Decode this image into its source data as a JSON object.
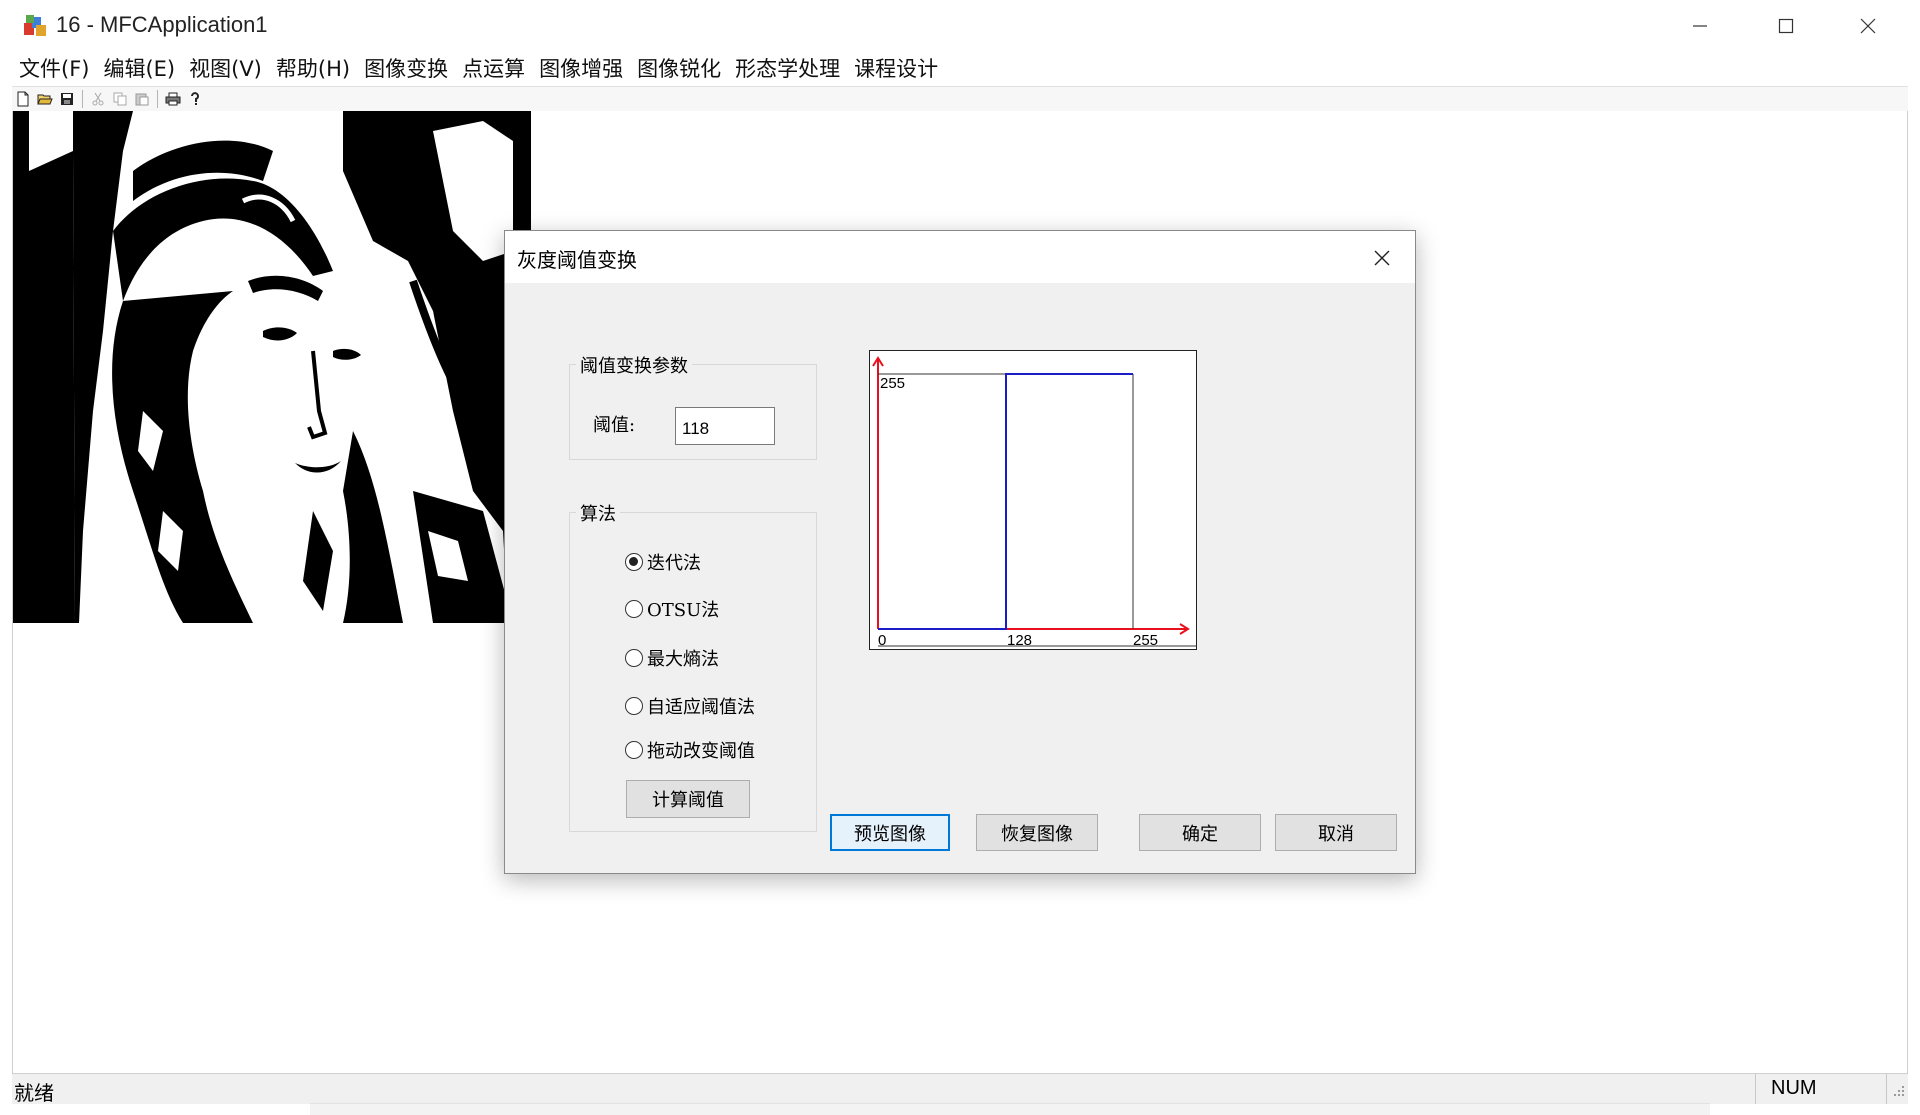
{
  "window": {
    "title": "16 - MFCApplication1",
    "icon": "mfc-app-icon"
  },
  "menubar": {
    "items": [
      {
        "label": "文件(F)"
      },
      {
        "label": "编辑(E)"
      },
      {
        "label": "视图(V)"
      },
      {
        "label": "帮助(H)"
      },
      {
        "label": "图像变换"
      },
      {
        "label": "点运算"
      },
      {
        "label": "图像增强"
      },
      {
        "label": "图像锐化"
      },
      {
        "label": "形态学处理"
      },
      {
        "label": "课程设计"
      }
    ]
  },
  "toolbar": {
    "buttons": [
      "new-icon",
      "open-icon",
      "save-icon",
      "cut-icon",
      "copy-icon",
      "paste-icon",
      "print-icon",
      "help-icon"
    ]
  },
  "dialog": {
    "title": "灰度阈值变换",
    "params_group": {
      "label": "阈值变换参数",
      "threshold_label": "阈值:",
      "threshold_value": "118"
    },
    "algo_group": {
      "label": "算法",
      "options": [
        {
          "label": "迭代法",
          "checked": true
        },
        {
          "label": "OTSU法",
          "checked": false
        },
        {
          "label": "最大熵法",
          "checked": false
        },
        {
          "label": "自适应阈值法",
          "checked": false
        },
        {
          "label": "拖动改变阈值",
          "checked": false
        }
      ],
      "compute_button": "计算阈值"
    },
    "graph": {
      "x_ticks": [
        "0",
        "128",
        "255"
      ],
      "y_tick": "255",
      "threshold_x": 128,
      "max": 255,
      "axis_color": "#e8101d",
      "curve_color": "#1d1dc7"
    },
    "buttons": {
      "preview": "预览图像",
      "restore": "恢复图像",
      "ok": "确定",
      "cancel": "取消"
    }
  },
  "statusbar": {
    "text": "就绪",
    "num": "NUM"
  }
}
